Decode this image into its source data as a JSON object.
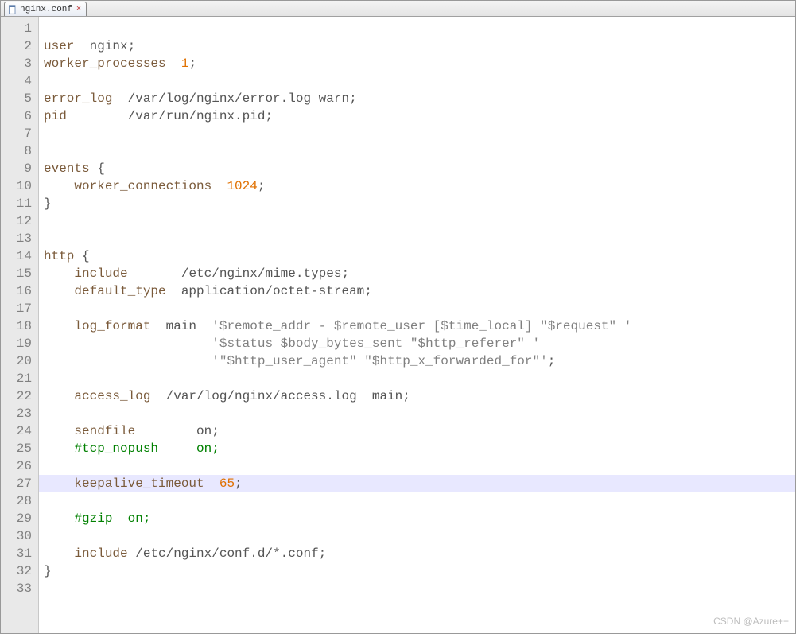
{
  "tab": {
    "filename": "nginx.conf"
  },
  "watermark": "CSDN @Azure++",
  "highlighted_line": 27,
  "lines": [
    {
      "n": 1,
      "tokens": []
    },
    {
      "n": 2,
      "tokens": [
        {
          "t": "user",
          "c": "kw"
        },
        {
          "t": "  ",
          "c": "txt"
        },
        {
          "t": "nginx",
          "c": "txt"
        },
        {
          "t": ";",
          "c": "txt"
        }
      ]
    },
    {
      "n": 3,
      "tokens": [
        {
          "t": "worker_processes",
          "c": "kw"
        },
        {
          "t": "  ",
          "c": "txt"
        },
        {
          "t": "1",
          "c": "num"
        },
        {
          "t": ";",
          "c": "txt"
        }
      ]
    },
    {
      "n": 4,
      "tokens": []
    },
    {
      "n": 5,
      "tokens": [
        {
          "t": "error_log",
          "c": "kw"
        },
        {
          "t": "  ",
          "c": "txt"
        },
        {
          "t": "/var/log/nginx/error.log",
          "c": "path"
        },
        {
          "t": " warn;",
          "c": "txt"
        }
      ]
    },
    {
      "n": 6,
      "tokens": [
        {
          "t": "pid",
          "c": "kw"
        },
        {
          "t": "        ",
          "c": "txt"
        },
        {
          "t": "/var/run/nginx.pid",
          "c": "path"
        },
        {
          "t": ";",
          "c": "txt"
        }
      ]
    },
    {
      "n": 7,
      "tokens": []
    },
    {
      "n": 8,
      "tokens": []
    },
    {
      "n": 9,
      "tokens": [
        {
          "t": "events",
          "c": "kw"
        },
        {
          "t": " ",
          "c": "txt"
        },
        {
          "t": "{",
          "c": "br"
        }
      ]
    },
    {
      "n": 10,
      "tokens": [
        {
          "t": "    ",
          "c": "txt"
        },
        {
          "t": "worker_connections",
          "c": "kw"
        },
        {
          "t": "  ",
          "c": "txt"
        },
        {
          "t": "1024",
          "c": "num"
        },
        {
          "t": ";",
          "c": "txt"
        }
      ]
    },
    {
      "n": 11,
      "tokens": [
        {
          "t": "}",
          "c": "br"
        }
      ]
    },
    {
      "n": 12,
      "tokens": []
    },
    {
      "n": 13,
      "tokens": []
    },
    {
      "n": 14,
      "tokens": [
        {
          "t": "http",
          "c": "kw"
        },
        {
          "t": " ",
          "c": "txt"
        },
        {
          "t": "{",
          "c": "br"
        }
      ]
    },
    {
      "n": 15,
      "tokens": [
        {
          "t": "    ",
          "c": "txt"
        },
        {
          "t": "include",
          "c": "kw"
        },
        {
          "t": "       ",
          "c": "txt"
        },
        {
          "t": "/etc/nginx/mime.types",
          "c": "path"
        },
        {
          "t": ";",
          "c": "txt"
        }
      ]
    },
    {
      "n": 16,
      "tokens": [
        {
          "t": "    ",
          "c": "txt"
        },
        {
          "t": "default_type",
          "c": "kw"
        },
        {
          "t": "  application/octet-stream;",
          "c": "txt"
        }
      ]
    },
    {
      "n": 17,
      "tokens": []
    },
    {
      "n": 18,
      "tokens": [
        {
          "t": "    ",
          "c": "txt"
        },
        {
          "t": "log_format",
          "c": "kw"
        },
        {
          "t": "  main  ",
          "c": "txt"
        },
        {
          "t": "'$remote_addr - $remote_user [$time_local] \"$request\" '",
          "c": "str"
        }
      ]
    },
    {
      "n": 19,
      "tokens": [
        {
          "t": "                      ",
          "c": "txt"
        },
        {
          "t": "'$status $body_bytes_sent \"$http_referer\" '",
          "c": "str"
        }
      ]
    },
    {
      "n": 20,
      "tokens": [
        {
          "t": "                      ",
          "c": "txt"
        },
        {
          "t": "'\"$http_user_agent\" \"$http_x_forwarded_for\"'",
          "c": "str"
        },
        {
          "t": ";",
          "c": "txt"
        }
      ]
    },
    {
      "n": 21,
      "tokens": []
    },
    {
      "n": 22,
      "tokens": [
        {
          "t": "    ",
          "c": "txt"
        },
        {
          "t": "access_log",
          "c": "kw"
        },
        {
          "t": "  ",
          "c": "txt"
        },
        {
          "t": "/var/log/nginx/access.log",
          "c": "path"
        },
        {
          "t": "  main;",
          "c": "txt"
        }
      ]
    },
    {
      "n": 23,
      "tokens": []
    },
    {
      "n": 24,
      "tokens": [
        {
          "t": "    ",
          "c": "txt"
        },
        {
          "t": "sendfile",
          "c": "kw"
        },
        {
          "t": "        on;",
          "c": "txt"
        }
      ]
    },
    {
      "n": 25,
      "tokens": [
        {
          "t": "    ",
          "c": "txt"
        },
        {
          "t": "#tcp_nopush     on;",
          "c": "cmt"
        }
      ]
    },
    {
      "n": 26,
      "tokens": []
    },
    {
      "n": 27,
      "tokens": [
        {
          "t": "    ",
          "c": "txt"
        },
        {
          "t": "keepalive_timeout",
          "c": "kw"
        },
        {
          "t": "  ",
          "c": "txt"
        },
        {
          "t": "65",
          "c": "num"
        },
        {
          "t": ";",
          "c": "txt"
        }
      ]
    },
    {
      "n": 28,
      "tokens": []
    },
    {
      "n": 29,
      "tokens": [
        {
          "t": "    ",
          "c": "txt"
        },
        {
          "t": "#gzip  on;",
          "c": "cmt"
        }
      ]
    },
    {
      "n": 30,
      "tokens": []
    },
    {
      "n": 31,
      "tokens": [
        {
          "t": "    ",
          "c": "txt"
        },
        {
          "t": "include",
          "c": "kw"
        },
        {
          "t": " ",
          "c": "txt"
        },
        {
          "t": "/etc/nginx/conf.d/*.conf",
          "c": "path"
        },
        {
          "t": ";",
          "c": "txt"
        }
      ]
    },
    {
      "n": 32,
      "tokens": [
        {
          "t": "}",
          "c": "br"
        }
      ]
    },
    {
      "n": 33,
      "tokens": []
    }
  ]
}
